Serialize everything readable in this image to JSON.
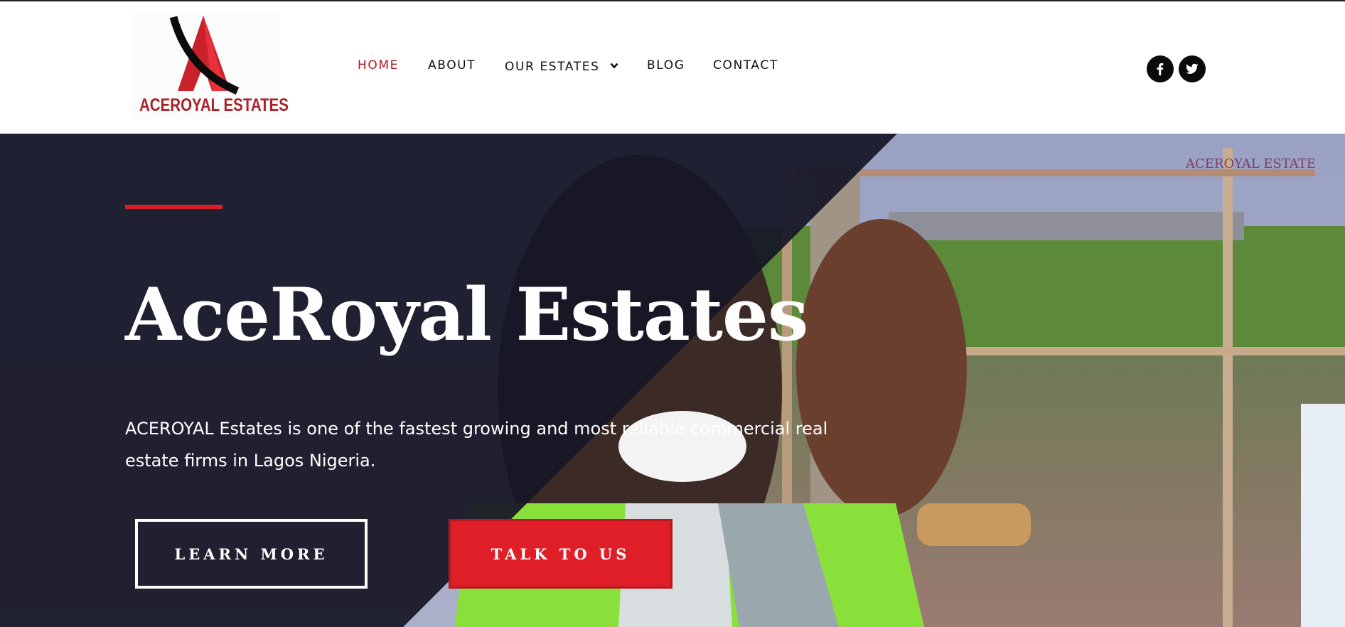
{
  "brand": {
    "logo_text": "ACEROYAL ESTATES"
  },
  "nav": {
    "items": [
      {
        "label": "HOME",
        "active": true
      },
      {
        "label": "ABOUT",
        "active": false
      },
      {
        "label": "OUR ESTATES",
        "active": false,
        "has_dropdown": true
      },
      {
        "label": "BLOG",
        "active": false
      },
      {
        "label": "CONTACT",
        "active": false
      }
    ]
  },
  "social": {
    "icons": [
      "facebook-icon",
      "twitter-icon"
    ]
  },
  "hero": {
    "title": "AceRoyal Estates",
    "description": "ACEROYAL  Estates is one of the fastest growing and most reliable commercial real estate firms in  Lagos  Nigeria.",
    "primary_button": "LEARN MORE",
    "secondary_button": "TALK TO US",
    "photo_watermark": "ACEROYAL ESTATE"
  },
  "colors": {
    "accent_red": "#e01e27",
    "active_nav": "#b5141f",
    "overlay": "#161626"
  }
}
